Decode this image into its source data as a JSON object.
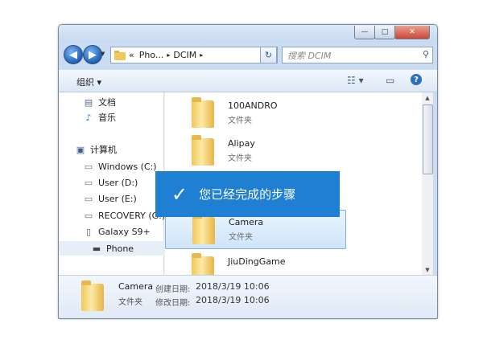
{
  "window": {
    "controls": {
      "minimize": "—",
      "maximize": "□",
      "close": "✕"
    }
  },
  "address_bar": {
    "back_icon": "back-arrow-icon",
    "forward_icon": "forward-arrow-icon",
    "overflow": "«",
    "crumbs": [
      "Pho...",
      "DCIM"
    ],
    "separator": "▸",
    "dropdown": "▾",
    "refresh": "↻"
  },
  "search": {
    "placeholder": "搜索 DCIM",
    "icon": "⚲"
  },
  "toolbar": {
    "organize_label": "组织 ▾",
    "view_icon": "☷ ▾",
    "pane_icon": "▭",
    "help_icon": "?"
  },
  "navigation": {
    "items": [
      {
        "label": "文档",
        "icon": "▤"
      },
      {
        "label": "音乐",
        "icon": "♪"
      },
      {
        "label": "计算机",
        "icon": "▣"
      },
      {
        "label": "Windows (C:)",
        "icon": "▭"
      },
      {
        "label": "User (D:)",
        "icon": "▭"
      },
      {
        "label": "User (E:)",
        "icon": "▭"
      },
      {
        "label": "RECOVERY (G:)",
        "icon": "▭"
      },
      {
        "label": "Galaxy S9+",
        "icon": "▯"
      },
      {
        "label": "Phone",
        "icon": "▬"
      }
    ]
  },
  "folders": [
    {
      "name": "100ANDRO",
      "type": "文件夹"
    },
    {
      "name": "Alipay",
      "type": "文件夹"
    },
    {
      "name": "",
      "type": ""
    },
    {
      "name": "Camera",
      "type": "文件夹"
    },
    {
      "name": "JiuDingGame",
      "type": ""
    }
  ],
  "details": {
    "name": "Camera",
    "type": "文件夹",
    "created_label": "创建日期:",
    "created_value": "2018/3/19 10:06",
    "modified_label": "修改日期:",
    "modified_value": "2018/3/19 10:06"
  },
  "banner": {
    "check": "✓",
    "text": "您已经完成的步骤"
  },
  "colors": {
    "banner": "#1f80d3",
    "selection": "#cfe5fa"
  }
}
